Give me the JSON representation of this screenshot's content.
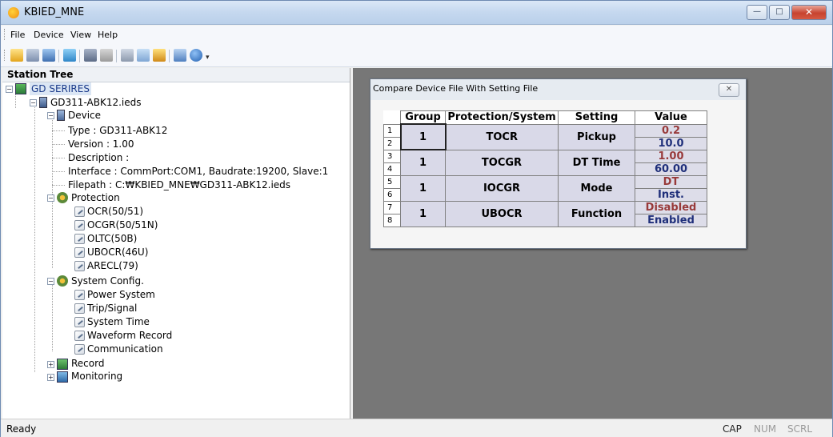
{
  "window": {
    "title": "KBIED_MNE",
    "buttons": {
      "minimize": "—",
      "maximize": "□",
      "close": "✕"
    }
  },
  "menu": [
    "File",
    "Device",
    "View",
    "Help"
  ],
  "toolbar_icons": [
    "open-icon",
    "save-icon",
    "connect-icon",
    "tree-icon",
    "send-icon",
    "receive-icon",
    "settings-icon",
    "monitor-icon",
    "list-icon",
    "window-icon",
    "help-icon"
  ],
  "station_tree": {
    "header": "Station Tree",
    "root": "GD SERIRES",
    "ied": "GD311-ABK12.ieds",
    "device": {
      "label": "Device",
      "type": "Type : GD311-ABK12",
      "version": "Version : 1.00",
      "description": "Description :",
      "interface": "Interface : CommPort:COM1, Baudrate:19200, Slave:1",
      "filepath": "Filepath : C:₩KBIED_MNE₩GD311-ABK12.ieds"
    },
    "protection": {
      "label": "Protection",
      "items": [
        "OCR(50/51)",
        "OCGR(50/51N)",
        "OLTC(50B)",
        "UBOCR(46U)",
        "ARECL(79)"
      ]
    },
    "system_config": {
      "label": "System Config.",
      "items": [
        "Power System",
        "Trip/Signal",
        "System Time",
        "Waveform Record",
        "Communication"
      ]
    },
    "record": "Record",
    "monitoring": "Monitoring"
  },
  "dialog": {
    "title": "Compare Device File With Setting File",
    "close": "✕",
    "columns": [
      "Group",
      "Protection/System",
      "Setting",
      "Value"
    ],
    "rows": [
      {
        "n1": "1",
        "n2": "2",
        "group": "1",
        "protection": "TOCR",
        "setting": "Pickup",
        "value1": "0.2",
        "value2": "10.0"
      },
      {
        "n1": "3",
        "n2": "4",
        "group": "1",
        "protection": "TOCGR",
        "setting": "DT Time",
        "value1": "1.00",
        "value2": "60.00"
      },
      {
        "n1": "5",
        "n2": "6",
        "group": "1",
        "protection": "IOCGR",
        "setting": "Mode",
        "value1": "DT",
        "value2": "Inst."
      },
      {
        "n1": "7",
        "n2": "8",
        "group": "1",
        "protection": "UBOCR",
        "setting": "Function",
        "value1": "Disabled",
        "value2": "Enabled"
      }
    ]
  },
  "status": {
    "text": "Ready",
    "cap": "CAP",
    "num": "NUM",
    "scrl": "SCRL"
  },
  "colors": {
    "value_top": "#983a3a",
    "value_bottom": "#1f2f7a",
    "workspace": "#777777"
  }
}
